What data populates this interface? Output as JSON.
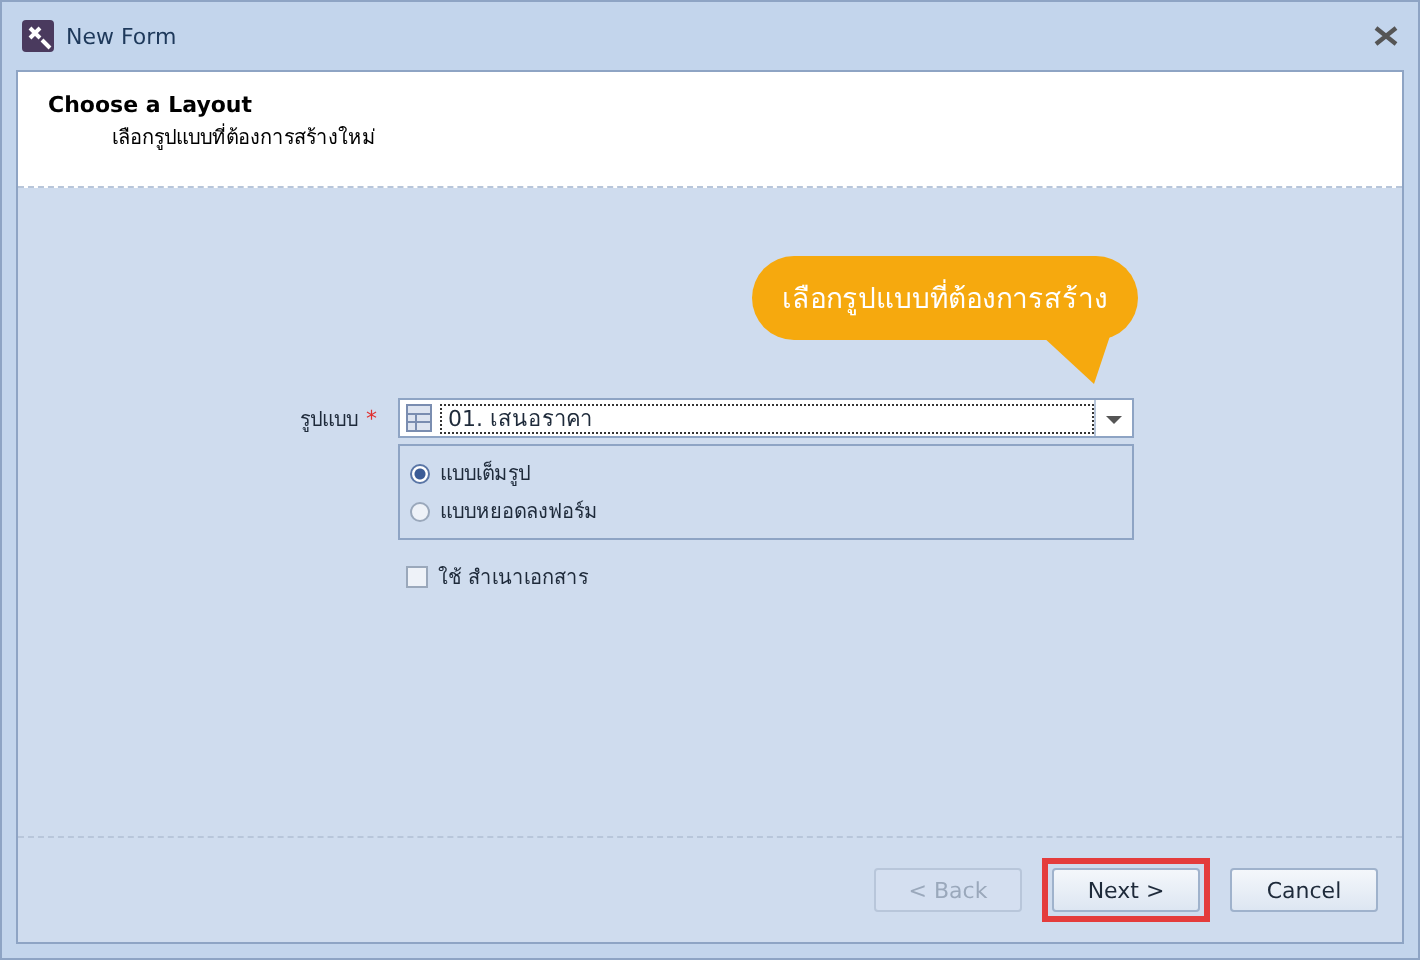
{
  "window": {
    "title": "New Form"
  },
  "header": {
    "title": "Choose a Layout",
    "subtitle": "เลือกรูปแบบที่ต้องการสร้างใหม่"
  },
  "callout": {
    "text": "เลือกรูปแบบที่ต้องการสร้าง"
  },
  "layout_field": {
    "label": "รูปแบบ",
    "required_mark": "*",
    "value": "01. เสนอราคา"
  },
  "options": [
    {
      "label": "แบบเต็มรูป",
      "selected": true
    },
    {
      "label": "แบบหยอดลงฟอร์ม",
      "selected": false
    }
  ],
  "copy_checkbox": {
    "label": "ใช้ สำเนาเอกสาร",
    "checked": false
  },
  "buttons": [
    {
      "label": "< Back",
      "disabled": true,
      "highlighted": false
    },
    {
      "label": "Next >",
      "disabled": false,
      "highlighted": true
    },
    {
      "label": "Cancel",
      "disabled": false,
      "highlighted": false
    }
  ]
}
